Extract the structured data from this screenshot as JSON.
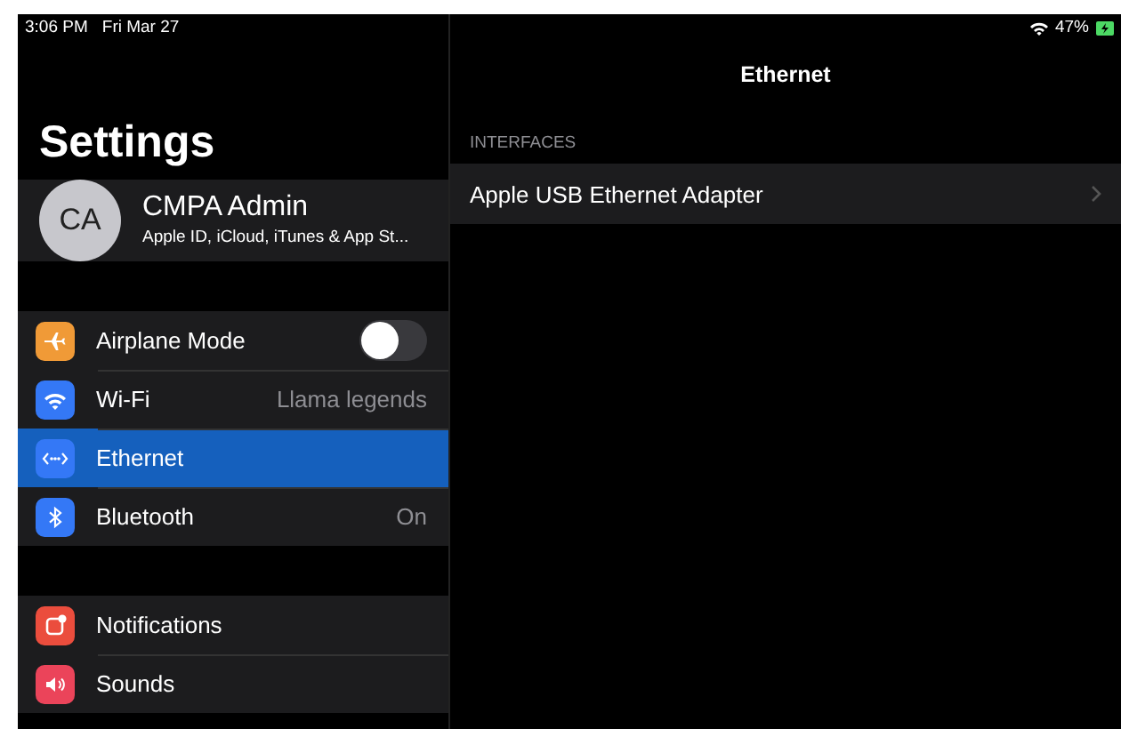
{
  "status_bar": {
    "time": "3:06 PM",
    "date": "Fri Mar 27",
    "battery": "47%"
  },
  "sidebar": {
    "title": "Settings",
    "profile": {
      "initials": "CA",
      "name": "CMPA Admin",
      "subtitle": "Apple ID, iCloud, iTunes & App St..."
    },
    "groups": [
      [
        {
          "label": "Airplane Mode",
          "color": "#f09a37",
          "kind": "toggle",
          "on": false,
          "selected": false
        },
        {
          "label": "Wi-Fi",
          "color": "#3478f6",
          "kind": "value",
          "value": "Llama legends",
          "selected": false
        },
        {
          "label": "Ethernet",
          "color": "#3478f6",
          "kind": "plain",
          "selected": true
        },
        {
          "label": "Bluetooth",
          "color": "#3478f6",
          "kind": "value",
          "value": "On",
          "selected": false
        }
      ],
      [
        {
          "label": "Notifications",
          "color": "#eb4d3d",
          "kind": "plain",
          "selected": false
        },
        {
          "label": "Sounds",
          "color": "#eb445a",
          "kind": "plain",
          "selected": false
        }
      ]
    ]
  },
  "detail": {
    "title": "Ethernet",
    "section": "INTERFACES",
    "rows": [
      {
        "label": "Apple USB Ethernet Adapter"
      }
    ]
  }
}
